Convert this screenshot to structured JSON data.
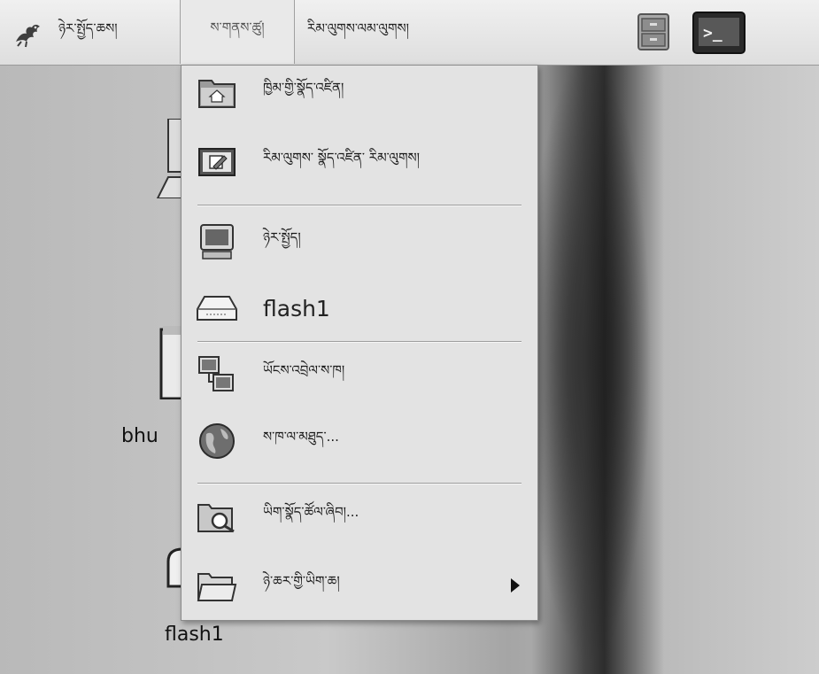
{
  "panel": {
    "apps_menu": "ཉེར་སྤྱོད་ཆས།",
    "places_menu": "ས་གནས་ཚུ།",
    "system_menu": "རིམ་ལུགས་ལམ་ལུགས།",
    "launchers": [
      {
        "name": "file-cabinet-icon"
      },
      {
        "name": "terminal-icon",
        "prompt": ">_"
      }
    ]
  },
  "places_menu": {
    "items": [
      {
        "label": "ཁྱིམ་གྱི་སྣོད་འཛིན།",
        "icon": "home-folder-icon"
      },
      {
        "label": "རིམ་ལུགས་ སྣོད་འཛིན་ རིམ་ལུགས།",
        "icon": "desktop-folder-icon"
      },
      {
        "label": "ཉེར་སྤྱོད།",
        "icon": "computer-icon"
      },
      {
        "label": "flash1",
        "icon": "drive-icon"
      },
      {
        "label": "ཡོངས་འབྲེལ་ས་ཁ།",
        "icon": "network-icon"
      },
      {
        "label": "ས་ཁ་ལ་མཐུད་...",
        "icon": "globe-icon"
      },
      {
        "label": "ཡིག་སྣོད་ཚོལ་ཞིབ།...",
        "icon": "search-folder-icon"
      },
      {
        "label": "ཉེ་ཆར་གྱི་ཡིག་ཆ།",
        "icon": "recent-folder-icon"
      }
    ]
  },
  "desktop": {
    "icons": [
      {
        "label": "bhu"
      },
      {
        "label": "flash1"
      }
    ]
  }
}
